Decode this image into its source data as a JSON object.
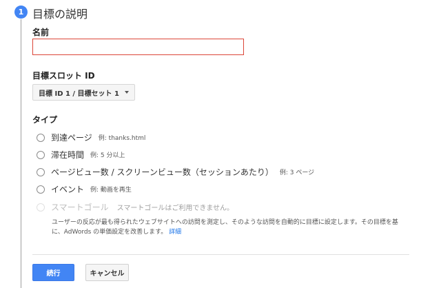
{
  "step": {
    "number": "1",
    "title": "目標の説明"
  },
  "name_field": {
    "label": "名前",
    "value": "",
    "placeholder": ""
  },
  "slot_field": {
    "label": "目標スロット ID",
    "selected": "目標 ID 1 / 目標セット 1"
  },
  "type_field": {
    "label": "タイプ",
    "options": [
      {
        "label": "到達ページ",
        "example": "例: thanks.html",
        "disabled": false
      },
      {
        "label": "滞在時間",
        "example": "例: 5 分以上",
        "disabled": false
      },
      {
        "label": "ページビュー数 / スクリーンビュー数（セッションあたり）",
        "example": "例: 3 ページ",
        "disabled": false
      },
      {
        "label": "イベント",
        "example": "例: 動画を再生",
        "disabled": false
      },
      {
        "label": "スマートゴール",
        "example": "スマートゴールはご利用できません。",
        "disabled": true
      }
    ],
    "smart_goal_note": "ユーザーの反応が最も得られたウェブサイトへの訪問を測定し、そのような訪問を自動的に目標に設定します。その目標を基に、AdWords の単価設定を改善します。",
    "smart_goal_link": "詳細"
  },
  "actions": {
    "continue_label": "続行",
    "cancel_label": "キャンセル"
  },
  "colors": {
    "accent": "#4285f4",
    "error_border": "#db4437",
    "link": "#1a73e8"
  }
}
